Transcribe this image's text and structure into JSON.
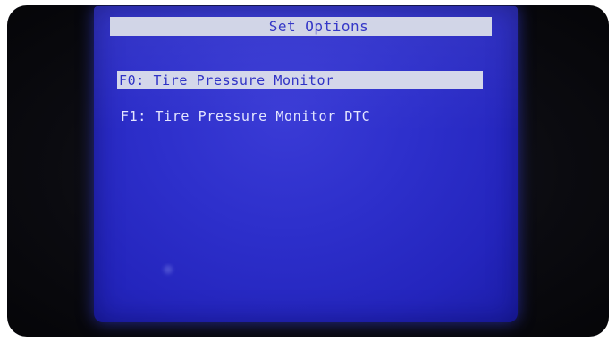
{
  "screen": {
    "title": "Set Options",
    "menu_items": [
      {
        "key": "F0",
        "label": "F0: Tire Pressure Monitor",
        "selected": true
      },
      {
        "key": "F1",
        "label": "F1: Tire Pressure Monitor DTC",
        "selected": false
      }
    ]
  },
  "colors": {
    "screen_background": "#2d2fcb",
    "title_bar": "#cfd3e6",
    "selected_highlight": "#d3d6ea",
    "text_on_blue": "#e4e6ff",
    "text_on_highlight": "#2a2dc4"
  }
}
